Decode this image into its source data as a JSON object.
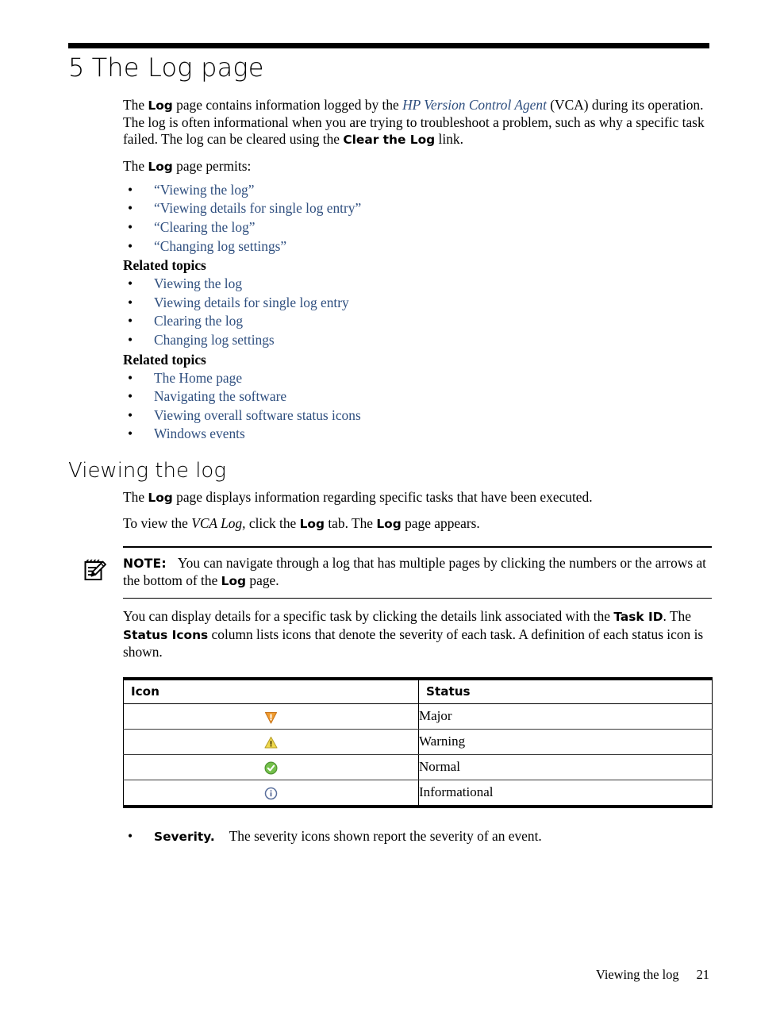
{
  "chapter": {
    "number": "5",
    "title": "The Log page"
  },
  "intro": {
    "p1_a": "The ",
    "p1_log": "Log",
    "p1_b": " page contains information logged by the ",
    "p1_link": "HP Version Control Agent",
    "p1_c": " (VCA) during its operation. The log is often informational when you are trying to troubleshoot a problem, such as why a specific task failed. The log can be cleared using the ",
    "p1_clear": "Clear the Log",
    "p1_d": " link.",
    "p2_a": "The ",
    "p2_log": "Log",
    "p2_b": " page permits:"
  },
  "permits_list": [
    "“Viewing the log”",
    "“Viewing details for single log entry”",
    "“Clearing the log”",
    "“Changing log settings”"
  ],
  "related_topics_1": {
    "heading": "Related topics",
    "items": [
      "Viewing the log",
      "Viewing details for single log entry",
      "Clearing the log",
      "Changing log settings"
    ]
  },
  "related_topics_2": {
    "heading": "Related topics",
    "items": [
      "The Home page",
      "Navigating the software",
      "Viewing overall software status icons",
      "Windows events"
    ]
  },
  "section": {
    "heading": "Viewing the log",
    "p1_a": "The ",
    "p1_log": "Log",
    "p1_b": " page displays information regarding specific tasks that have been executed.",
    "p2_a": "To view the ",
    "p2_vca": "VCA Log,",
    "p2_b": " click the ",
    "p2_log1": "Log",
    "p2_c": " tab. The ",
    "p2_log2": "Log",
    "p2_d": " page appears."
  },
  "note": {
    "icon": "note-pad-pencil-icon",
    "label": "NOTE:",
    "text_a": "You can navigate through a log that has multiple pages by clicking the numbers or the arrows at the bottom of the ",
    "text_log": "Log",
    "text_b": " page."
  },
  "after_note": {
    "a": "You can display details for a specific task by clicking the details link associated with the ",
    "task_id": "Task ID",
    "b": ". The ",
    "status_icons": "Status Icons",
    "c": " column lists icons that denote the severity of each task. A definition of each status icon is shown."
  },
  "status_table": {
    "headers": [
      "Icon",
      "Status"
    ],
    "rows": [
      {
        "icon": "major-severity-icon",
        "status": "Major"
      },
      {
        "icon": "warning-severity-icon",
        "status": "Warning"
      },
      {
        "icon": "normal-severity-icon",
        "status": "Normal"
      },
      {
        "icon": "informational-severity-icon",
        "status": "Informational"
      }
    ]
  },
  "severity_bullet": {
    "label": "Severity.",
    "text": "The severity icons shown report the severity of an event."
  },
  "footer": {
    "section": "Viewing the log",
    "page_number": "21"
  },
  "colors": {
    "link": "#2f4f7f",
    "major": "#e8952d",
    "warning": "#e8d44d",
    "normal": "#6cbf4a",
    "informational": "#5a6f9c",
    "rule": "#000000"
  }
}
